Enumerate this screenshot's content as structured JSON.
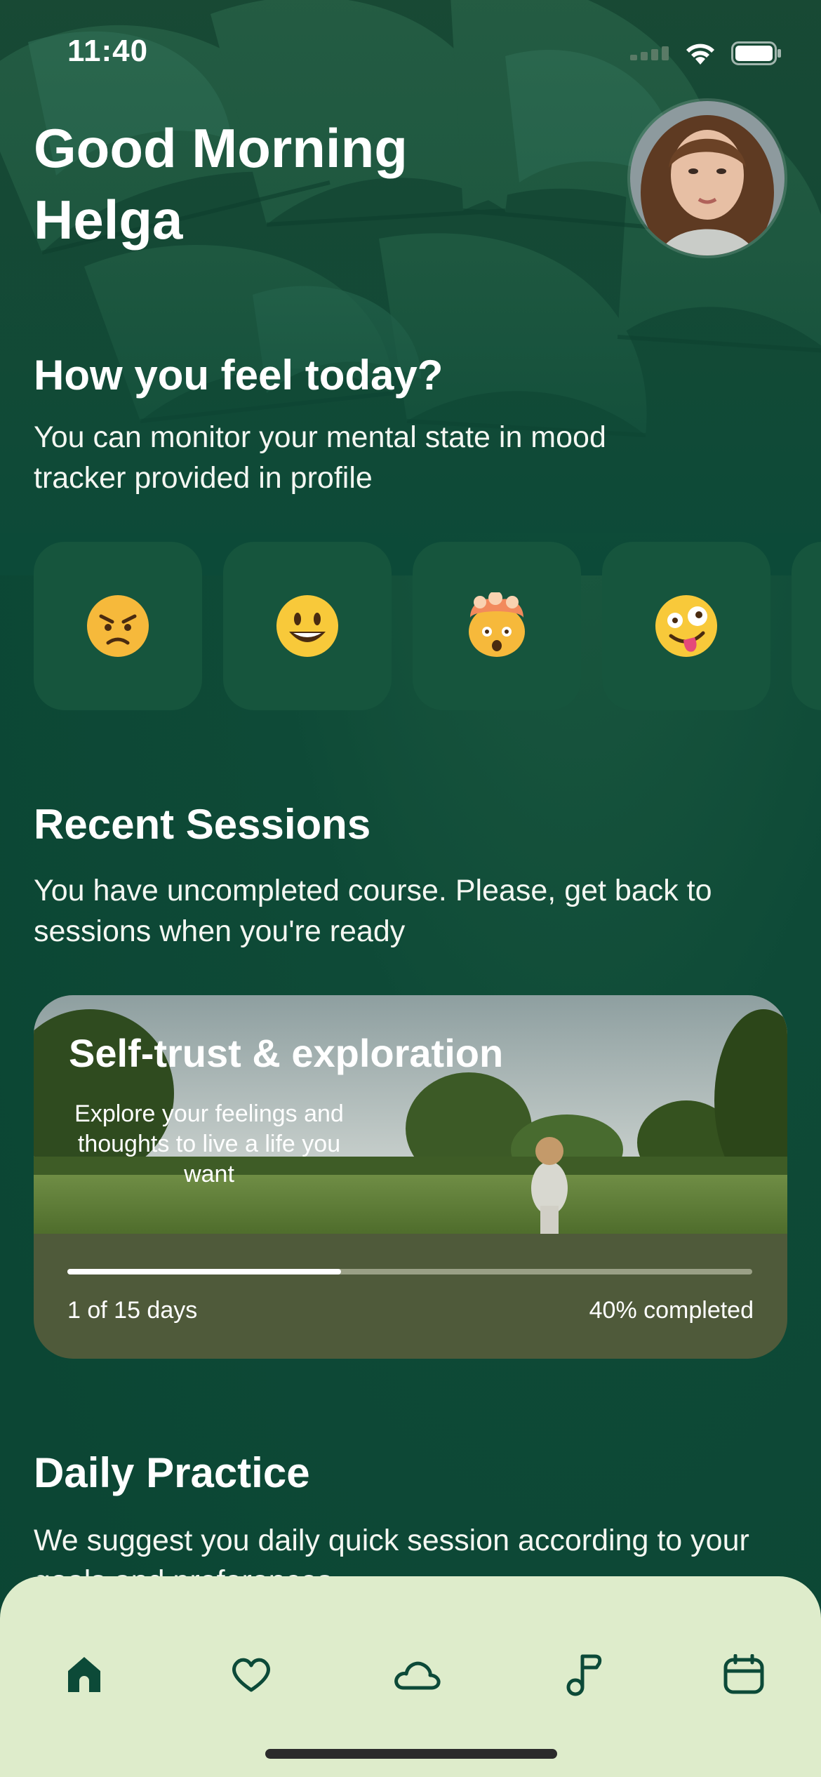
{
  "status_bar": {
    "time": "11:40"
  },
  "header": {
    "greeting": "Good Morning Helga"
  },
  "mood": {
    "title": "How you feel today?",
    "description": "You can monitor your mental state in mood  tracker provided in profile",
    "options": [
      {
        "emoji": "angry-face"
      },
      {
        "emoji": "smiling-face"
      },
      {
        "emoji": "exploding-head"
      },
      {
        "emoji": "zany-face"
      }
    ]
  },
  "recent_sessions": {
    "title": "Recent Sessions",
    "description": "You have uncompleted course. Please, get back to sessions when you're ready",
    "course": {
      "title": "Self-trust & exploration",
      "subtitle": "Explore your feelings and thoughts to live a life you want",
      "days": "1 of 15 days",
      "completed": "40% completed",
      "progress": 0.4
    }
  },
  "daily_practice": {
    "title": "Daily Practice",
    "description": "We suggest you daily quick session according to your goals and preferences"
  },
  "tab_bar": {
    "tabs": [
      {
        "icon": "home-icon",
        "active": true
      },
      {
        "icon": "heart-icon",
        "active": false
      },
      {
        "icon": "cloud-icon",
        "active": false
      },
      {
        "icon": "music-note-icon",
        "active": false
      },
      {
        "icon": "calendar-icon",
        "active": false
      }
    ]
  },
  "colors": {
    "accent": "#0c4a38",
    "tab_bg": "#deeccb",
    "card": "#16553d"
  }
}
